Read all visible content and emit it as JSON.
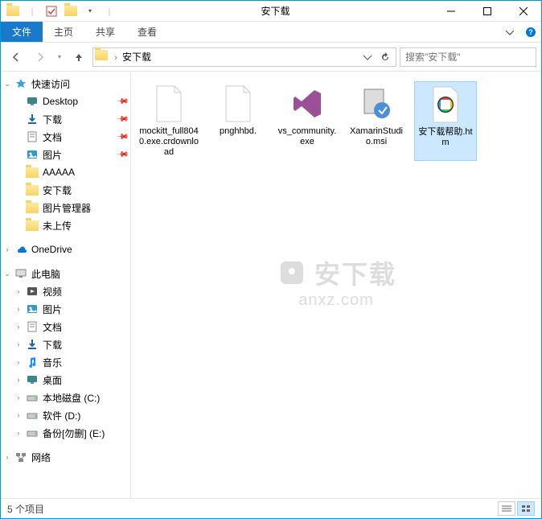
{
  "titleBar": {
    "title": "安下载"
  },
  "ribbon": {
    "fileTab": "文件",
    "tabs": [
      "主页",
      "共享",
      "查看"
    ]
  },
  "nav": {
    "breadcrumb": "安下载",
    "searchPlaceholder": "搜索\"安下载\""
  },
  "sidebar": {
    "quickAccess": "快速访问",
    "quickItems": [
      {
        "label": "Desktop",
        "icon": "desktop",
        "pinned": true
      },
      {
        "label": "下载",
        "icon": "downloads",
        "pinned": true
      },
      {
        "label": "文档",
        "icon": "documents",
        "pinned": true
      },
      {
        "label": "图片",
        "icon": "pictures",
        "pinned": true
      },
      {
        "label": "AAAAA",
        "icon": "folder",
        "pinned": false
      },
      {
        "label": "安下载",
        "icon": "folder",
        "pinned": false
      },
      {
        "label": "图片管理器",
        "icon": "folder",
        "pinned": false
      },
      {
        "label": "未上传",
        "icon": "folder",
        "pinned": false
      }
    ],
    "oneDrive": "OneDrive",
    "thisPC": "此电脑",
    "pcItems": [
      {
        "label": "视频",
        "icon": "videos"
      },
      {
        "label": "图片",
        "icon": "pictures"
      },
      {
        "label": "文档",
        "icon": "documents"
      },
      {
        "label": "下载",
        "icon": "downloads"
      },
      {
        "label": "音乐",
        "icon": "music"
      },
      {
        "label": "桌面",
        "icon": "desktop"
      },
      {
        "label": "本地磁盘 (C:)",
        "icon": "drive"
      },
      {
        "label": "软件 (D:)",
        "icon": "drive"
      },
      {
        "label": "备份[勿删] (E:)",
        "icon": "drive"
      }
    ],
    "network": "网络"
  },
  "files": [
    {
      "name": "mockitt_full8040.exe.crdownload",
      "type": "blank"
    },
    {
      "name": "pnghhbd.",
      "type": "blank"
    },
    {
      "name": "vs_community.exe",
      "type": "vs"
    },
    {
      "name": "XamarinStudio.msi",
      "type": "msi"
    },
    {
      "name": "安下载帮助.htm",
      "type": "htm",
      "selected": true
    }
  ],
  "statusBar": {
    "itemCount": "5 个项目"
  },
  "watermark": {
    "line1": "安下载",
    "line2": "anxz.com"
  }
}
